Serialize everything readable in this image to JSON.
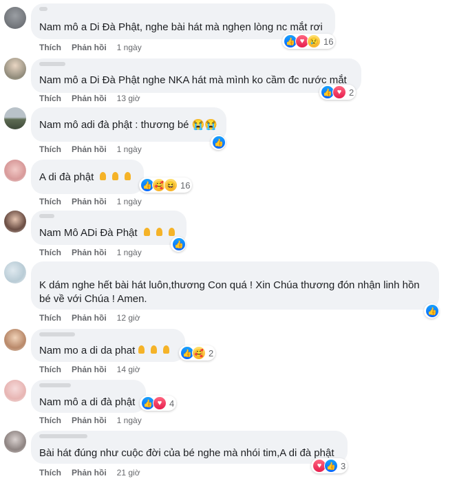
{
  "labels": {
    "like": "Thích",
    "reply": "Phản hồi"
  },
  "comments": [
    {
      "text": "Nam mô a Di Đà Phật, nghe bài hát mà nghẹn lòng nc mắt rơi",
      "time": "1 ngày",
      "reactions": [
        "like-icon",
        "love-icon",
        "sad-icon"
      ],
      "count": "16"
    },
    {
      "text": "Nam mô a Di Đà Phật nghe NKA hát mà mình ko cầm đc nước mắt",
      "time": "13 giờ",
      "reactions": [
        "like-icon",
        "love-icon"
      ],
      "count": "2"
    },
    {
      "text": "Nam mô adi đà phật : thương bé 😭😭",
      "time": "1 ngày",
      "reactions": [
        "like-icon"
      ],
      "count": ""
    },
    {
      "text": "A di đà phật",
      "time": "1 ngày",
      "reactions": [
        "like-icon",
        "care-icon",
        "haha-icon"
      ],
      "count": "16",
      "pray": 3
    },
    {
      "text": "Nam Mô ADi Đà Phật",
      "time": "1 ngày",
      "reactions": [
        "like-icon"
      ],
      "count": "",
      "pray": 3
    },
    {
      "text": "K dám nghe hết bài hát luôn,thương Con quá ! Xin Chúa thương đón nhận linh hồn bé về với Chúa ! Amen.",
      "time": "12 giờ",
      "reactions": [
        "like-icon"
      ],
      "count": ""
    },
    {
      "text": "Nam mo a di da phat",
      "time": "14 giờ",
      "reactions": [
        "like-icon",
        "care-icon"
      ],
      "count": "2",
      "pray": 3
    },
    {
      "text": "Nam mô a di đà phật",
      "time": "1 ngày",
      "reactions": [
        "like-icon",
        "love-icon"
      ],
      "count": "4"
    },
    {
      "text": "Bài hát đúng như cuộc đời của bé nghe mà nhói tim,A di đà phật",
      "time": "21 giờ",
      "reactions": [
        "love-icon",
        "like-icon"
      ],
      "count": "3"
    }
  ],
  "colors": {
    "bubble": "#f0f2f5",
    "like": "#0866ff",
    "love": "#e61e4d",
    "emoji": "#f7b125",
    "meta": "#65676b"
  }
}
